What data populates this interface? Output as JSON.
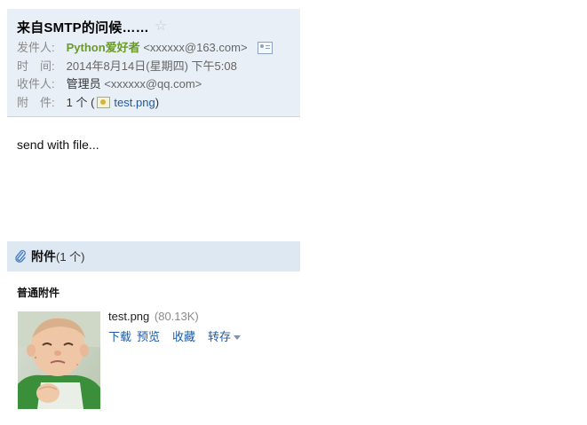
{
  "header": {
    "subject": "来自SMTP的问候……",
    "star_icon": "star-outline-icon",
    "from_label": "发件人:",
    "from_name": "Python爱好者",
    "from_addr": "<xxxxxx@163.com>",
    "time_label": "时　间:",
    "time_value": "2014年8月14日(星期四) 下午5:08",
    "to_label": "收件人:",
    "to_name": "管理员",
    "to_addr": "<xxxxxx@qq.com>",
    "attach_label": "附　件:",
    "attach_prefix": "1 个 (",
    "attach_file": "test.png",
    "attach_suffix": ")"
  },
  "body": {
    "text": "send with file..."
  },
  "attachments": {
    "title": "附件",
    "count": "(1 个)",
    "section": "普通附件",
    "file_name": "test.png",
    "file_size": "(80.13K)",
    "actions": {
      "download": "下载",
      "preview": "预览",
      "collect": "收藏",
      "save_to": "转存"
    }
  },
  "colors": {
    "header_bg": "#e9eff6",
    "attach_bar_bg": "#dde8f3",
    "link": "#1c5aa6",
    "sender": "#6a9a2a"
  }
}
